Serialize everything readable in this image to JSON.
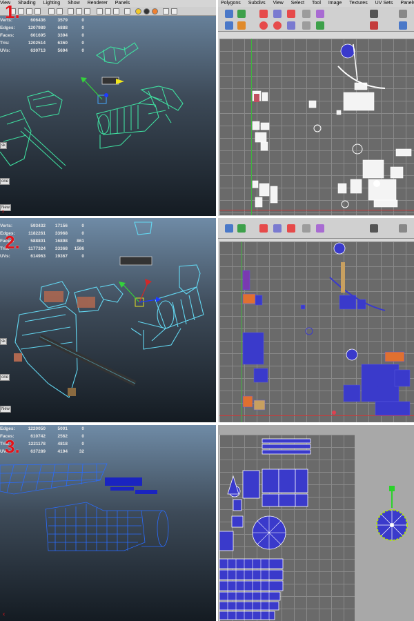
{
  "panel1": {
    "number": "1.",
    "menu": [
      "View",
      "Shading",
      "Lighting",
      "Show",
      "Renderer",
      "Panels"
    ],
    "uv_menu": [
      "Polygons",
      "Subdivs",
      "View",
      "Select",
      "Tool",
      "Image",
      "Textures",
      "UV Sets",
      "Panels"
    ],
    "stats": [
      {
        "label": "Verts:",
        "a": "606436",
        "b": "3579",
        "c": "0"
      },
      {
        "label": "Edges:",
        "a": "1207989",
        "b": "6888",
        "c": "0"
      },
      {
        "label": "Faces:",
        "a": "601695",
        "b": "3394",
        "c": "0"
      },
      {
        "label": "Tris:",
        "a": "1202514",
        "b": "6360",
        "c": "0"
      },
      {
        "label": "UVs:",
        "a": "630713",
        "b": "5694",
        "c": "0"
      }
    ],
    "tabs": [
      "sk",
      "one",
      "New"
    ]
  },
  "panel2": {
    "number": "2.",
    "stats": [
      {
        "label": "Verts:",
        "a": "593432",
        "b": "17156",
        "c": "0"
      },
      {
        "label": "Edges:",
        "a": "1182261",
        "b": "33968",
        "c": "0"
      },
      {
        "label": "Faces:",
        "a": "588801",
        "b": "16898",
        "c": "861"
      },
      {
        "label": "Tris:",
        "a": "1177324",
        "b": "33368",
        "c": "1586"
      },
      {
        "label": "UVs:",
        "a": "614963",
        "b": "19367",
        "c": "0"
      }
    ],
    "tabs": [
      "sk",
      "one",
      "New"
    ]
  },
  "panel3": {
    "number": "3.",
    "stats": [
      {
        "label": "Edges:",
        "a": "1220050",
        "b": "5001",
        "c": "0"
      },
      {
        "label": "Faces:",
        "a": "610742",
        "b": "2562",
        "c": "0"
      },
      {
        "label": "Tris:",
        "a": "1221178",
        "b": "4818",
        "c": "0"
      },
      {
        "label": "UVs:",
        "a": "637289",
        "b": "4194",
        "c": "32"
      }
    ]
  },
  "colors": {
    "accent_red": "#e0141b",
    "wire_green": "#3fe0a0",
    "wire_cyan": "#63d8f2",
    "uv_blue": "#3a3acb",
    "grid_bg": "#6a6a6a"
  },
  "icons": [
    "select-icon",
    "move-icon",
    "rotate-icon",
    "scale-icon",
    "wireframe-icon",
    "smooth-shade-icon",
    "texture-icon",
    "light-icon",
    "uv-snapshot-icon",
    "checker-icon"
  ]
}
